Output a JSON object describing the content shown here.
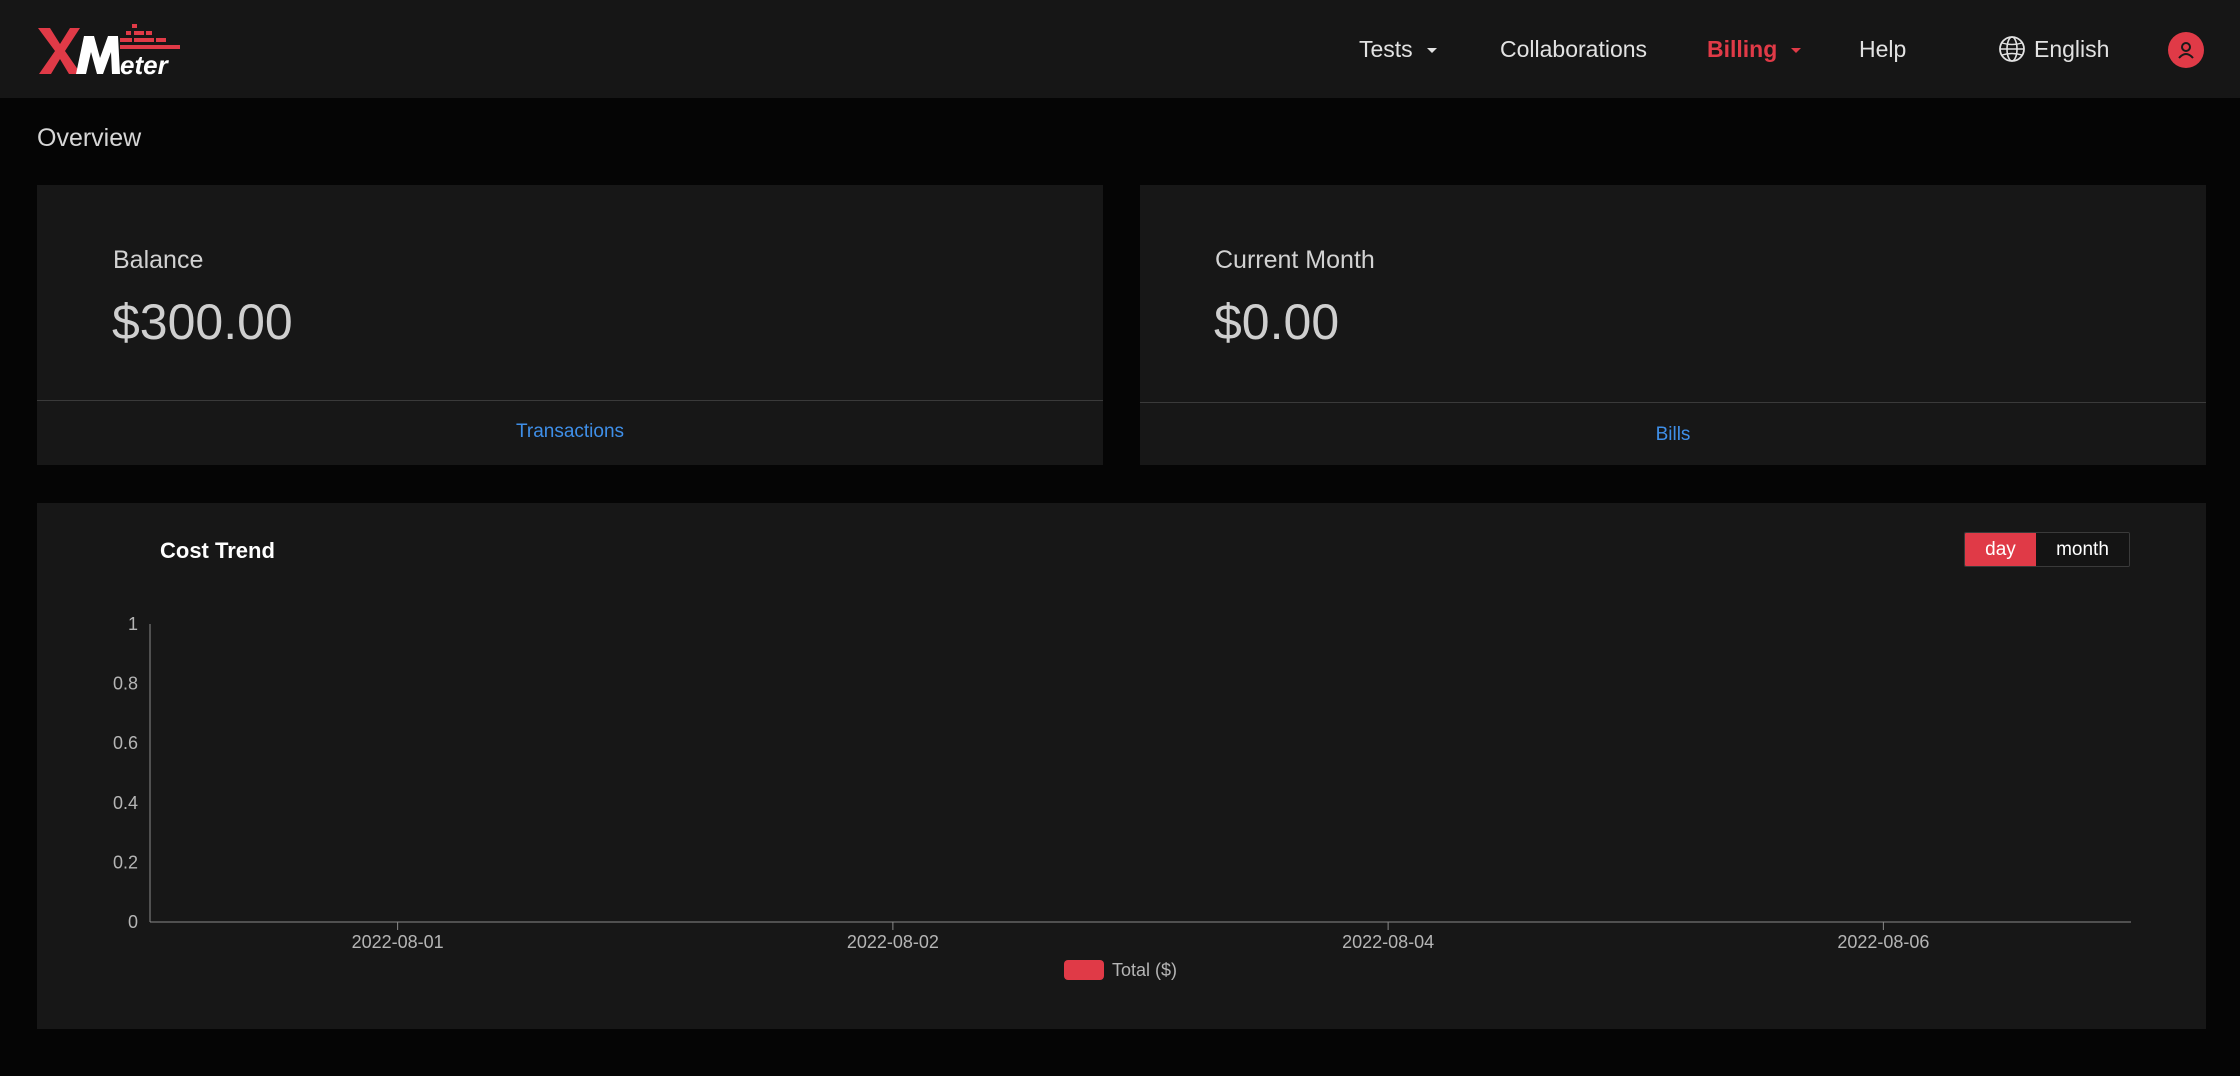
{
  "header": {
    "logo": "XMeter",
    "nav": {
      "tests": "Tests",
      "collaborations": "Collaborations",
      "billing": "Billing",
      "help": "Help",
      "language": "English"
    },
    "accent_color": "#e03a47"
  },
  "overview": {
    "title": "Overview",
    "balance": {
      "label": "Balance",
      "value": "$300.00",
      "link": "Transactions"
    },
    "current_month": {
      "label": "Current Month",
      "value": "$0.00",
      "link": "Bills"
    }
  },
  "cost_trend": {
    "title": "Cost Trend",
    "toggle": {
      "day": "day",
      "month": "month",
      "selected": "day"
    }
  },
  "chart_data": {
    "type": "bar",
    "title": "Cost Trend",
    "categories": [
      "2022-08-01",
      "2022-08-02",
      "2022-08-04",
      "2022-08-06"
    ],
    "series": [
      {
        "name": "Total ($)",
        "values": [
          0,
          0,
          0,
          0
        ],
        "color": "#e03a47"
      }
    ],
    "yticks": [
      "0",
      "0.2",
      "0.4",
      "0.6",
      "0.8",
      "1"
    ],
    "ylim": [
      0,
      1
    ],
    "xlabel": "",
    "ylabel": "",
    "grid": false,
    "legend": "bottom-center"
  }
}
